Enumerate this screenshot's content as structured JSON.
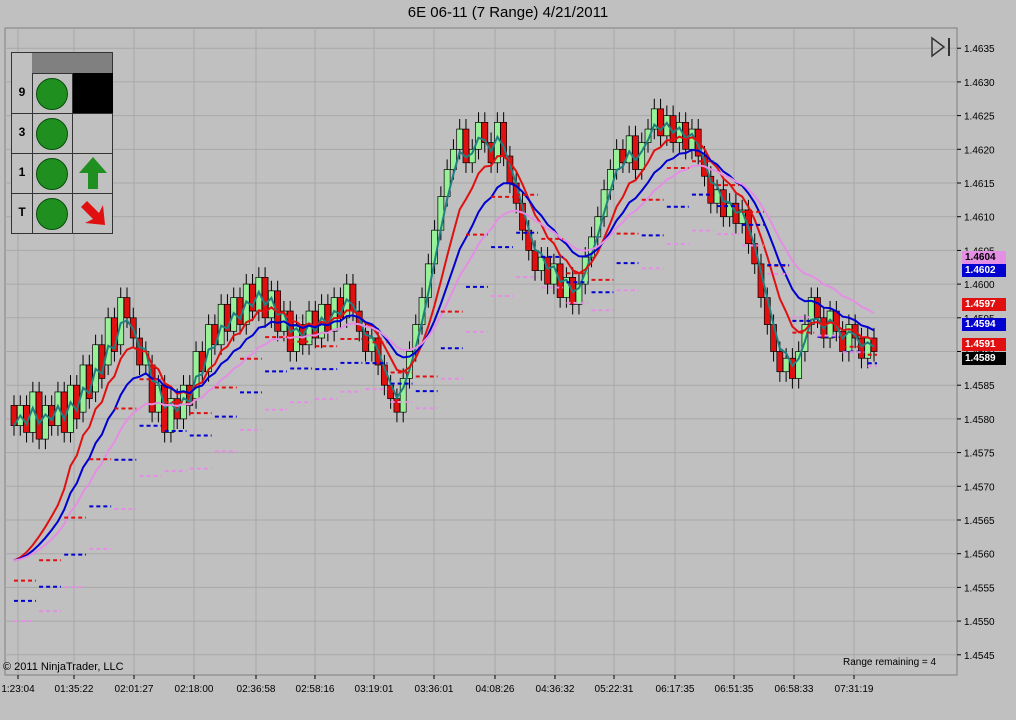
{
  "title": "6E 06-11 (7 Range)  4/21/2011",
  "copyright": "© 2011 NinjaTrader, LLC",
  "range_remaining": "Range remaining = 4",
  "signal_panel": {
    "rows": [
      {
        "label": "9",
        "dot": "green",
        "cell": "black"
      },
      {
        "label": "3",
        "dot": "green",
        "cell": "empty"
      },
      {
        "label": "1",
        "dot": "green",
        "cell": "up-arrow-green"
      },
      {
        "label": "T",
        "dot": "green",
        "cell": "down-right-arrow-red"
      }
    ]
  },
  "price_tags": [
    {
      "value": "1.4604",
      "bg": "#e48fe4",
      "fg": "#000000"
    },
    {
      "value": "1.4602",
      "bg": "#0000d0",
      "fg": "#ffffff"
    },
    {
      "value": "1.4597",
      "bg": "#e01010",
      "fg": "#ffffff"
    },
    {
      "value": "1.4594",
      "bg": "#0000d0",
      "fg": "#ffffff"
    },
    {
      "value": "1.4591",
      "bg": "#e01010",
      "fg": "#ffffff"
    },
    {
      "value": "1.4589",
      "bg": "#000000",
      "fg": "#ffffff"
    }
  ],
  "chart_data": {
    "type": "candlestick",
    "title": "6E 06-11 (7 Range)  4/21/2011",
    "ylim": [
      1.4542,
      1.4638
    ],
    "y_ticks": [
      "1.4545",
      "1.4550",
      "1.4555",
      "1.4560",
      "1.4565",
      "1.4570",
      "1.4575",
      "1.4580",
      "1.4585",
      "1.4590",
      "1.4595",
      "1.4600",
      "1.4605",
      "1.4610",
      "1.4615",
      "1.4620",
      "1.4625",
      "1.4630",
      "1.4635"
    ],
    "x_ticks": [
      "1:23:04",
      "01:35:22",
      "02:01:27",
      "02:18:00",
      "02:36:58",
      "02:58:16",
      "03:19:01",
      "03:36:01",
      "04:08:26",
      "04:36:32",
      "05:22:31",
      "06:17:35",
      "06:51:35",
      "06:58:33",
      "07:31:19"
    ],
    "grid": true,
    "closes": [
      1.4579,
      1.4582,
      1.4578,
      1.4584,
      1.4577,
      1.4582,
      1.4579,
      1.4584,
      1.4578,
      1.4585,
      1.458,
      1.4588,
      1.4583,
      1.4591,
      1.4586,
      1.4595,
      1.459,
      1.4598,
      1.4595,
      1.4592,
      1.4588,
      1.459,
      1.4581,
      1.4585,
      1.4578,
      1.4583,
      1.458,
      1.4585,
      1.4582,
      1.459,
      1.4587,
      1.4594,
      1.4591,
      1.4597,
      1.4593,
      1.4598,
      1.4594,
      1.46,
      1.4596,
      1.4601,
      1.4595,
      1.4599,
      1.4593,
      1.4596,
      1.459,
      1.4594,
      1.4591,
      1.4596,
      1.4592,
      1.4597,
      1.4593,
      1.4598,
      1.4595,
      1.46,
      1.4596,
      1.4593,
      1.459,
      1.4592,
      1.4588,
      1.4585,
      1.4583,
      1.4581,
      1.4586,
      1.459,
      1.4594,
      1.4598,
      1.4603,
      1.4608,
      1.4613,
      1.4617,
      1.462,
      1.4623,
      1.4618,
      1.462,
      1.4624,
      1.4621,
      1.4618,
      1.4624,
      1.4619,
      1.4615,
      1.4612,
      1.4608,
      1.4605,
      1.4602,
      1.4604,
      1.46,
      1.4603,
      1.4598,
      1.4601,
      1.4597,
      1.46,
      1.4604,
      1.4607,
      1.461,
      1.4614,
      1.4617,
      1.462,
      1.4618,
      1.4622,
      1.4617,
      1.4621,
      1.4623,
      1.4626,
      1.4622,
      1.4625,
      1.4621,
      1.4624,
      1.462,
      1.4623,
      1.4619,
      1.4616,
      1.4612,
      1.4614,
      1.461,
      1.4612,
      1.4609,
      1.4611,
      1.4606,
      1.4603,
      1.4598,
      1.4594,
      1.459,
      1.4587,
      1.4589,
      1.4586,
      1.459,
      1.4594,
      1.4598,
      1.4595,
      1.4592,
      1.4596,
      1.4593,
      1.459,
      1.4594,
      1.4592,
      1.4589,
      1.4592,
      1.459
    ]
  }
}
